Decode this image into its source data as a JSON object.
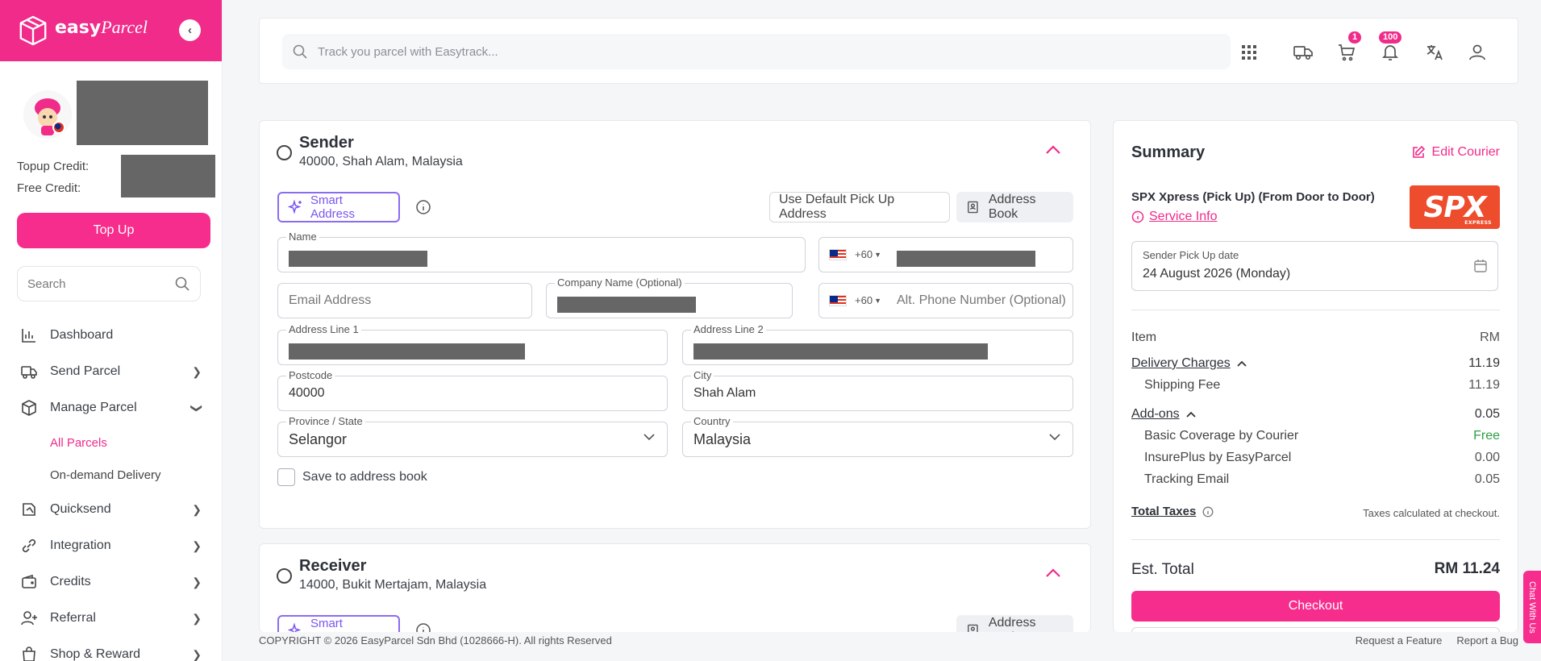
{
  "brand": {
    "name": "easy",
    "name_script": "Parcel",
    "accent": "#f02b8a"
  },
  "sidebar": {
    "topup_credit_label": "Topup Credit:",
    "free_credit_label": "Free Credit:",
    "topup_button": "Top Up",
    "search_placeholder": "Search",
    "nav": [
      {
        "label": "Dashboard",
        "icon": "bar-chart-icon"
      },
      {
        "label": "Send Parcel",
        "icon": "delivery-truck-icon"
      },
      {
        "label": "Manage Parcel",
        "icon": "box-icon"
      },
      {
        "label": "Quicksend",
        "icon": "quicksend-icon"
      },
      {
        "label": "Integration",
        "icon": "link-icon"
      },
      {
        "label": "Credits",
        "icon": "wallet-icon"
      },
      {
        "label": "Referral",
        "icon": "user-plus-icon"
      },
      {
        "label": "Shop & Reward",
        "icon": "shopping-bag-icon"
      }
    ],
    "sub_items": [
      "All Parcels",
      "On-demand Delivery"
    ]
  },
  "topbar": {
    "search_placeholder": "Track you parcel with Easytrack...",
    "cart_badge": "1",
    "notification_badge": "100"
  },
  "sender": {
    "title": "Sender",
    "subtitle": "40000, Shah Alam, Malaysia",
    "smart_address": "Smart Address",
    "use_default": "Use Default Pick Up Address",
    "address_book": "Address Book",
    "fields": {
      "name_label": "Name",
      "phone_code": "+60",
      "email_placeholder": "Email Address",
      "company_label": "Company Name (Optional)",
      "alt_phone_placeholder": "Alt. Phone Number (Optional)",
      "address1_label": "Address Line 1",
      "address2_label": "Address Line 2",
      "postcode_label": "Postcode",
      "postcode_value": "40000",
      "city_label": "City",
      "city_value": "Shah Alam",
      "state_label": "Province / State",
      "state_value": "Selangor",
      "country_label": "Country",
      "country_value": "Malaysia"
    },
    "save_label": "Save to address book"
  },
  "receiver": {
    "title": "Receiver",
    "subtitle": "14000, Bukit Mertajam, Malaysia",
    "smart_address": "Smart Address",
    "address_book": "Address Book"
  },
  "summary": {
    "title": "Summary",
    "edit_courier": "Edit Courier",
    "courier_name": "SPX Xpress (Pick Up) (From Door to Door)",
    "service_info": "Service Info",
    "courier_logo_text": "SPX",
    "courier_logo_sub": "EXPRESS",
    "pickup_label": "Sender Pick Up date",
    "pickup_value": "24 August 2026 (Monday)",
    "item_header": "Item",
    "currency_header": "RM",
    "delivery_charges": "Delivery Charges",
    "delivery_charges_value": "11.19",
    "shipping_fee": "Shipping Fee",
    "shipping_fee_value": "11.19",
    "addons": "Add-ons",
    "addons_value": "0.05",
    "basic_coverage": "Basic Coverage by Courier",
    "basic_coverage_value": "Free",
    "insureplus": "InsurePlus by EasyParcel",
    "insureplus_value": "0.00",
    "tracking_email": "Tracking Email",
    "tracking_email_value": "0.05",
    "total_taxes": "Total Taxes",
    "taxes_note": "Taxes calculated at checkout.",
    "est_total_label": "Est. Total",
    "est_total_value": "RM 11.24",
    "checkout": "Checkout"
  },
  "footer": {
    "copyright": "COPYRIGHT © 2026 EasyParcel Sdn Bhd (1028666-H). All rights Reserved",
    "request_feature": "Request a Feature",
    "report_bug": "Report a Bug"
  },
  "chat_tab": "Chat With Us"
}
